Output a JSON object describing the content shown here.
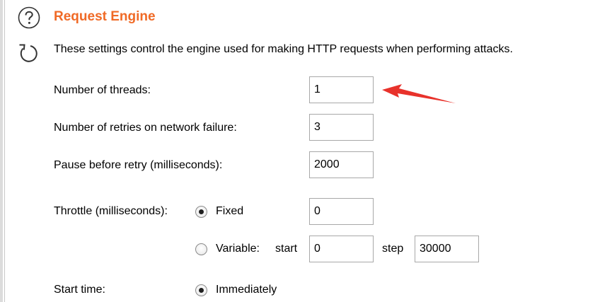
{
  "section": {
    "title": "Request Engine",
    "description": "These settings control the engine used for making HTTP requests when performing attacks."
  },
  "icons": {
    "help": "help-circle-icon",
    "refresh": "refresh-icon"
  },
  "settings": {
    "threads": {
      "label": "Number of threads:",
      "value": "1"
    },
    "retries": {
      "label": "Number of retries on network failure:",
      "value": "3"
    },
    "pause": {
      "label": "Pause before retry (milliseconds):",
      "value": "2000"
    },
    "throttle": {
      "label": "Throttle (milliseconds):",
      "fixed": {
        "label": "Fixed",
        "value": "0",
        "selected": true
      },
      "variable": {
        "label": "Variable:",
        "start_label": "start",
        "start_value": "0",
        "step_label": "step",
        "step_value": "30000",
        "selected": false
      }
    },
    "start_time": {
      "label": "Start time:",
      "option": "Immediately",
      "selected": true
    }
  },
  "colors": {
    "title": "#f06a26",
    "annotation_arrow": "#e8322b"
  }
}
